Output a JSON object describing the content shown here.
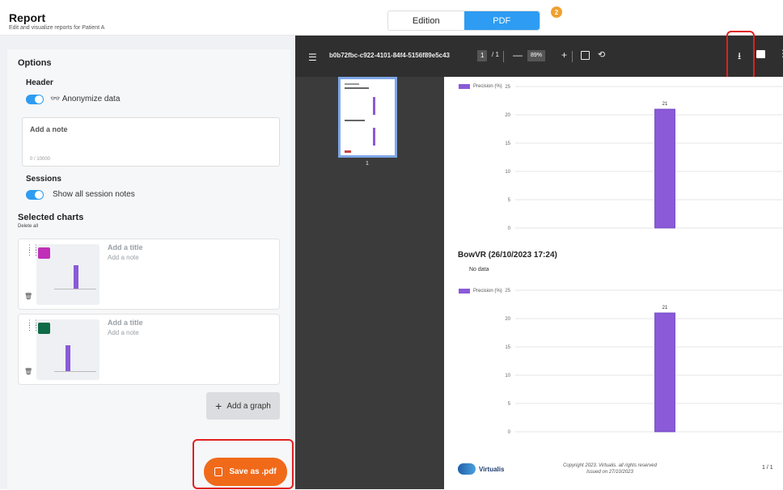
{
  "header": {
    "title": "Report",
    "subtitle": "Edit and visualize reports for Patient A",
    "tabs": [
      {
        "label": "Edition",
        "active": false
      },
      {
        "label": "PDF",
        "active": true
      }
    ],
    "pdf_badge": "2"
  },
  "options": {
    "title": "Options",
    "header_section": "Header",
    "anonymize_label": "Anonymize data",
    "anonymize_on": true,
    "note_placeholder": "Add a note",
    "note_counter": "0 / 10000",
    "sessions_section": "Sessions",
    "session_notes_label": "Show all session notes",
    "session_notes_on": true,
    "selected_charts_title": "Selected charts",
    "delete_all": "Delete all",
    "charts": [
      {
        "title_placeholder": "Add a title",
        "note_placeholder": "Add a note",
        "icon_color": "#c02fb8"
      },
      {
        "title_placeholder": "Add a title",
        "note_placeholder": "Add a note",
        "icon_color": "#0f6b46"
      }
    ],
    "add_graph_label": "Add a graph",
    "save_label": "Save as .pdf"
  },
  "viewer": {
    "filename": "b0b72fbc-c922-4101-84f4-5156f89e5c43",
    "page_current": "1",
    "page_total": "1",
    "zoom": "89%",
    "thumbnail_page": "1",
    "icons": [
      "menu-icon",
      "fit-page-icon",
      "rotate-icon",
      "download-icon",
      "print-icon",
      "more-icon"
    ]
  },
  "pdf_page": {
    "section2_title": "BowVR (26/10/2023 17:24)",
    "no_data": "No data",
    "footer_logo": "Virtualis",
    "footer_copyright_1": "Copyright 2023. Virtualis. all rights reserved",
    "footer_copyright_2": "Issued on 27/10/2023",
    "footer_page": "1 / 1"
  },
  "chart_data": [
    {
      "type": "bar",
      "categories": [
        ""
      ],
      "series": [
        {
          "name": "Precision (%)",
          "values": [
            21
          ]
        }
      ],
      "yticks": [
        0,
        5,
        10,
        15,
        20,
        25
      ],
      "ylim": [
        0,
        25
      ],
      "data_labels": [
        "21"
      ],
      "color": "#8a5ad8"
    },
    {
      "type": "bar",
      "categories": [
        ""
      ],
      "series": [
        {
          "name": "Precision (%)",
          "values": [
            21
          ]
        }
      ],
      "yticks": [
        0,
        5,
        10,
        15,
        20,
        25
      ],
      "ylim": [
        0,
        25
      ],
      "data_labels": [
        "21"
      ],
      "color": "#8a5ad8"
    }
  ]
}
